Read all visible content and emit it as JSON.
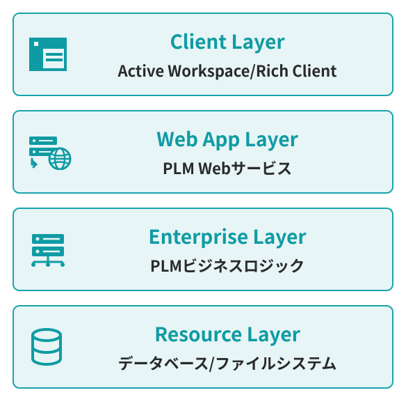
{
  "colors": {
    "accent": "#0f9ba3",
    "border": "#18a4ac",
    "background": "#e7f5f6",
    "text": "#2a2a2a"
  },
  "layers": [
    {
      "title": "Client Layer",
      "subtitle": "Active Workspace/Rich Client",
      "icon": "workspace-icon"
    },
    {
      "title": "Web App Layer",
      "subtitle": "PLM Webサービス",
      "icon": "web-server-icon"
    },
    {
      "title": "Enterprise Layer",
      "subtitle": "PLMビジネスロジック",
      "icon": "server-icon"
    },
    {
      "title": "Resource Layer",
      "subtitle": "データベース/ファイルシステム",
      "icon": "database-icon"
    }
  ]
}
